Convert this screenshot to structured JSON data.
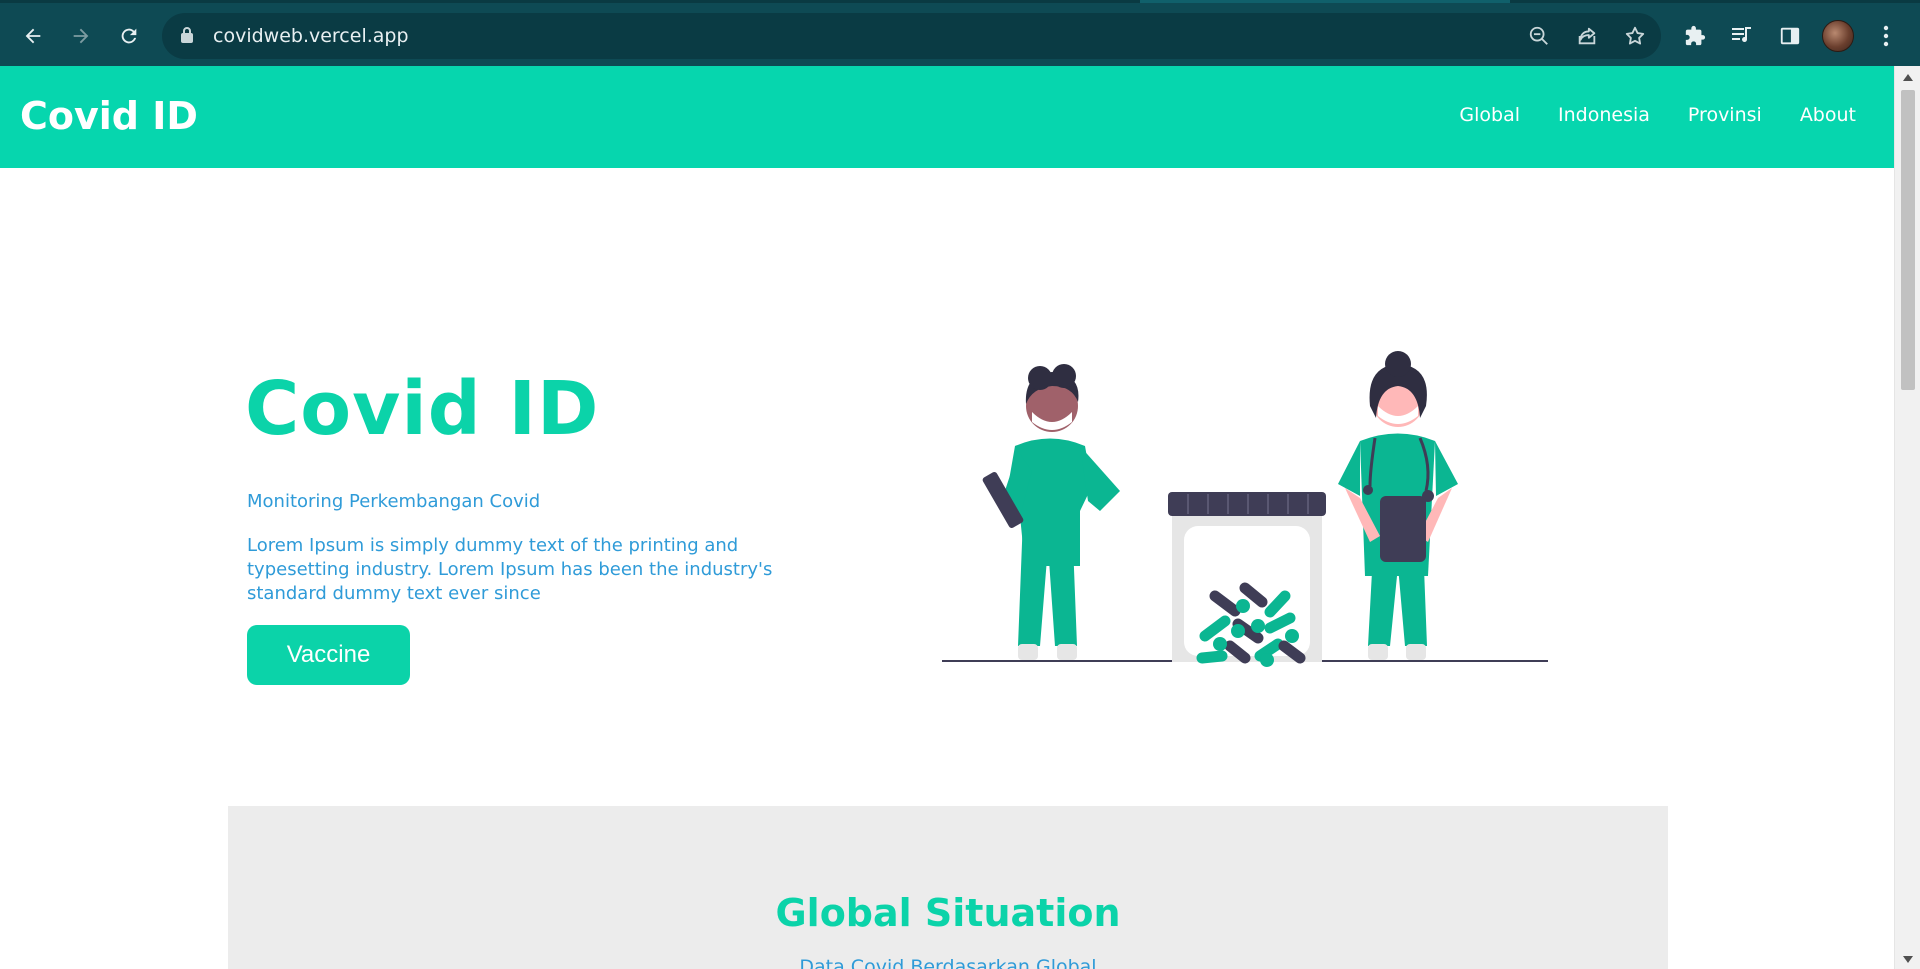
{
  "browser": {
    "url": "covidweb.vercel.app",
    "icons": [
      "back-icon",
      "forward-icon",
      "reload-icon",
      "lock-icon",
      "zoom-out-icon",
      "share-icon",
      "star-icon",
      "extensions-icon",
      "media-icon",
      "side-panel-icon",
      "avatar",
      "menu-icon"
    ]
  },
  "site": {
    "brand": "Covid ID",
    "nav": [
      "Global",
      "Indonesia",
      "Provinsi",
      "About"
    ],
    "accent": "#06d6ae"
  },
  "hero": {
    "title": "Covid ID",
    "subtitle": "Monitoring Perkembangan Covid",
    "description": "Lorem Ipsum is simply dummy text of the printing and typesetting industry. Lorem Ipsum has been the industry's standard dummy text ever since",
    "button_label": "Vaccine"
  },
  "global": {
    "title": "Global Situation",
    "subtitle": "Data Covid Berdasarkan Global"
  }
}
